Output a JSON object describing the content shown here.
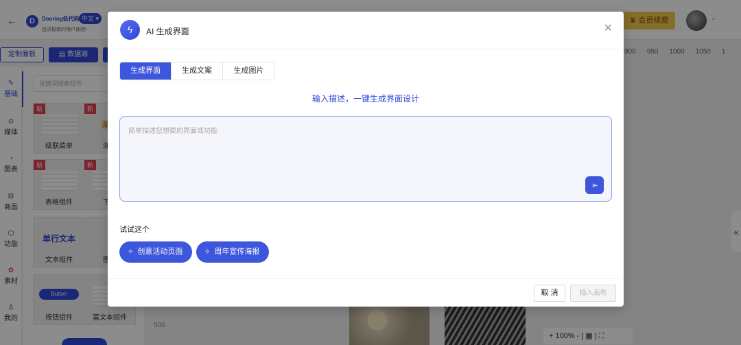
{
  "app": {
    "brand": "Dooring低代码",
    "slogan": "追求极致的用户体验!",
    "language": "中文 ▾",
    "member_button": "会员续费",
    "toolbar": {
      "panel_label": "定制面板",
      "data_label": "数据源"
    },
    "rail": [
      {
        "label": "基础",
        "icon": "brush-icon"
      },
      {
        "label": "媒体",
        "icon": "play-icon"
      },
      {
        "label": "图表",
        "icon": "pie-icon"
      },
      {
        "label": "商品",
        "icon": "cart-icon"
      },
      {
        "label": "功能",
        "icon": "cube-icon"
      },
      {
        "label": "素材",
        "icon": "flower-icon"
      },
      {
        "label": "我的",
        "icon": "user-icon"
      }
    ],
    "component_search_placeholder": "关键词搜索组件",
    "components": [
      {
        "name": "级联菜单",
        "badge": "新"
      },
      {
        "name": "渐变",
        "badge": "新"
      },
      {
        "name": "表格组件",
        "badge": "新"
      },
      {
        "name": "下拉",
        "badge": "新"
      },
      {
        "name": "文本组件",
        "preview": "单行文本"
      },
      {
        "name": "图片"
      },
      {
        "name": "按钮组件",
        "preview": "Button"
      },
      {
        "name": "富文本组件"
      }
    ],
    "ruler_ticks": [
      "900",
      "950",
      "1000",
      "1050",
      "1"
    ],
    "ruler_left": "500",
    "zoom": "+ 100% - | ▦ | ⛶"
  },
  "modal": {
    "title": "AI 生成界面",
    "tabs": [
      {
        "label": "生成界面",
        "active": true
      },
      {
        "label": "生成文案",
        "active": false
      },
      {
        "label": "生成图片",
        "active": false
      }
    ],
    "subtitle": "输入描述，一键生成界面设计",
    "prompt_placeholder": "简单描述您想要的界面或功能",
    "try_label": "试试这个",
    "suggestions": [
      "创意活动页面",
      "周年宣传海报"
    ],
    "cancel_label": "取 消",
    "insert_label": "插入画布"
  },
  "colors": {
    "accent": "#3d56dc",
    "member": "#f2c74e"
  }
}
